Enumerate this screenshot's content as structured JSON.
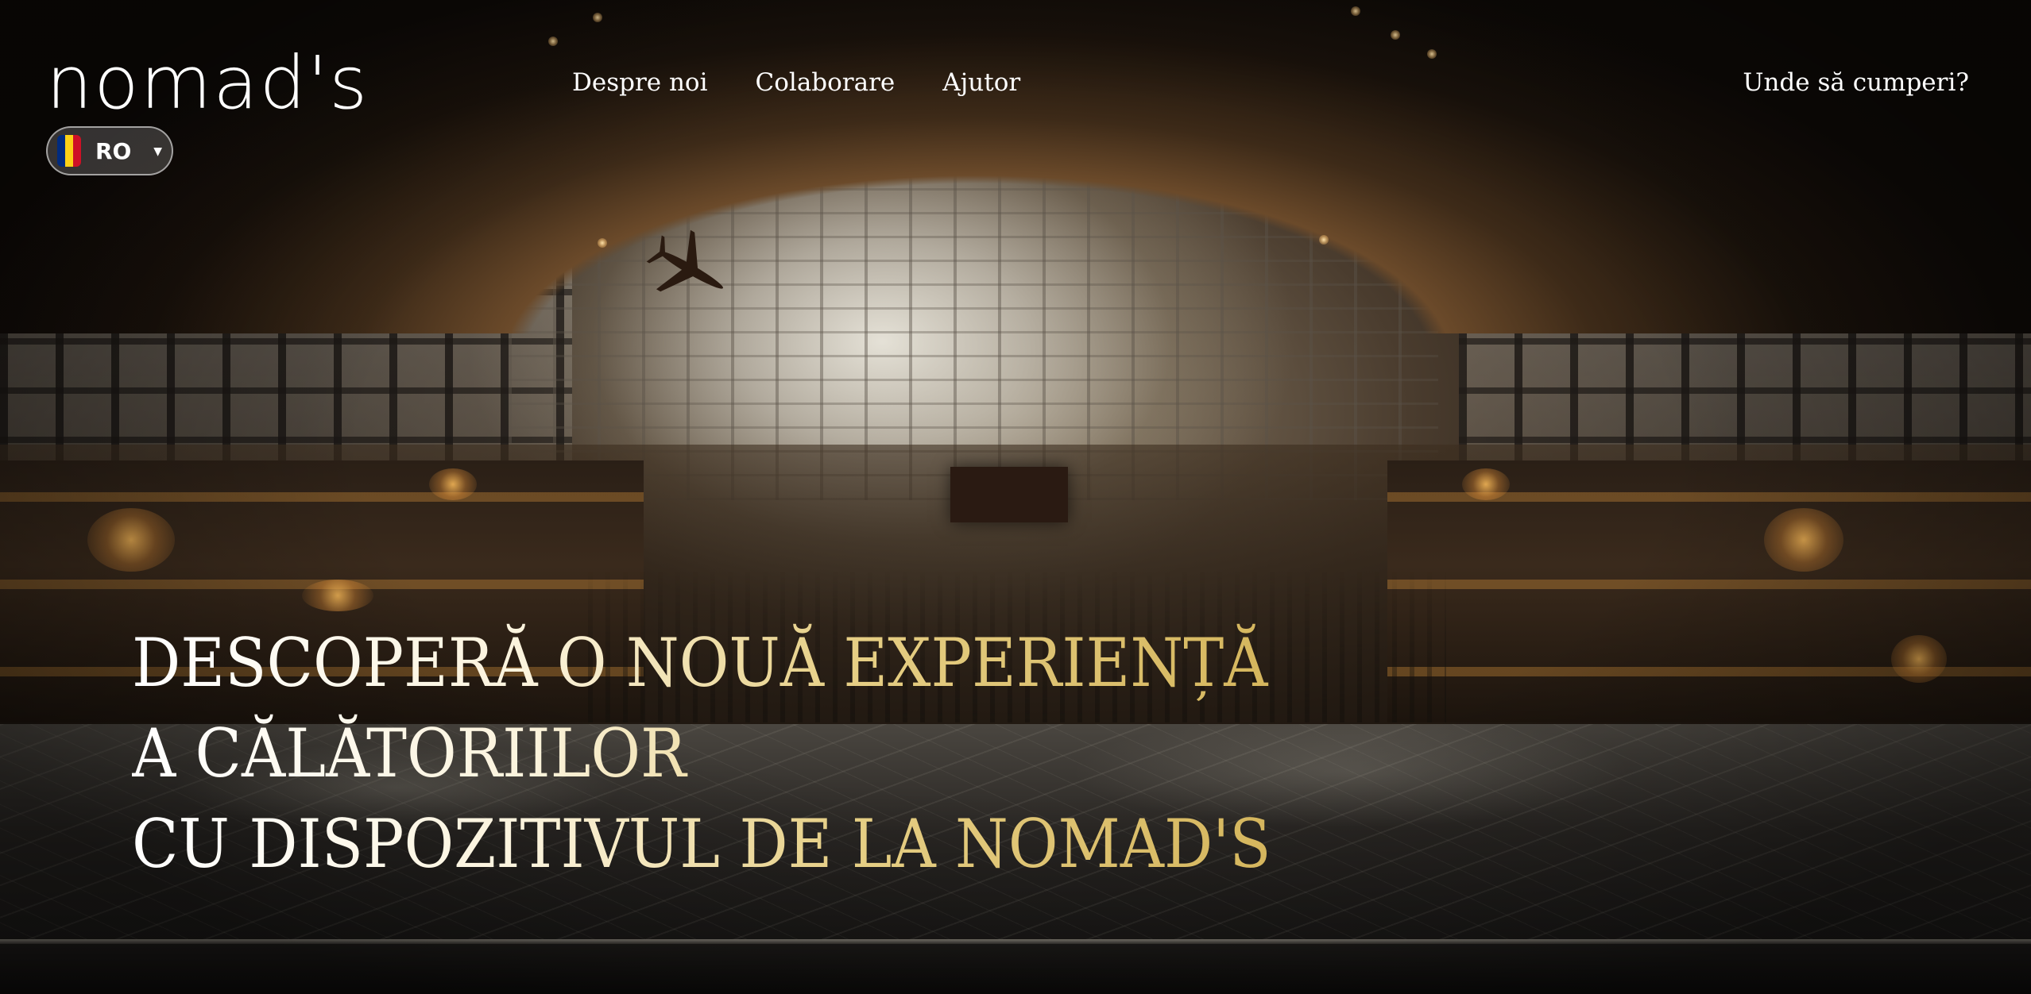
{
  "header": {
    "logo_text": "nomad's",
    "language": {
      "code": "RO",
      "flag_colors": [
        "#002B7F",
        "#FCD116",
        "#CE1126"
      ]
    },
    "nav": [
      {
        "label": "Despre noi"
      },
      {
        "label": "Colaborare"
      },
      {
        "label": "Ajutor"
      }
    ],
    "shop_link": "Unde să cumperi?"
  },
  "hero": {
    "headline_lines": [
      "DESCOPERĂ O NOUĂ EXPERIENȚĂ",
      "A CĂLĂTORIILOR",
      "CU DISPOZITIVUL DE LA NOMAD'S"
    ],
    "headline_gradient": [
      "#ffffff",
      "#d5b65d"
    ]
  }
}
